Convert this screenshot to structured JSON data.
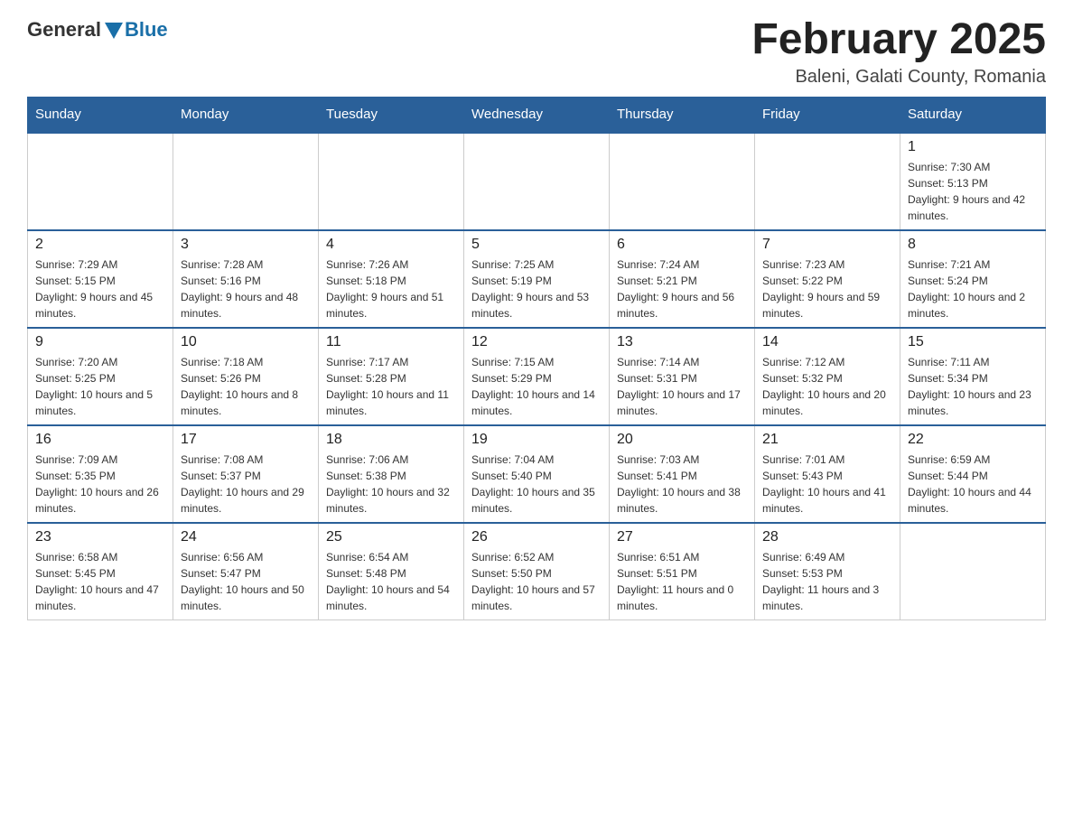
{
  "header": {
    "logo_general": "General",
    "logo_blue": "Blue",
    "month_year": "February 2025",
    "location": "Baleni, Galati County, Romania"
  },
  "weekdays": [
    "Sunday",
    "Monday",
    "Tuesday",
    "Wednesday",
    "Thursday",
    "Friday",
    "Saturday"
  ],
  "weeks": [
    {
      "days": [
        {
          "number": "",
          "info": ""
        },
        {
          "number": "",
          "info": ""
        },
        {
          "number": "",
          "info": ""
        },
        {
          "number": "",
          "info": ""
        },
        {
          "number": "",
          "info": ""
        },
        {
          "number": "",
          "info": ""
        },
        {
          "number": "1",
          "info": "Sunrise: 7:30 AM\nSunset: 5:13 PM\nDaylight: 9 hours and 42 minutes."
        }
      ]
    },
    {
      "days": [
        {
          "number": "2",
          "info": "Sunrise: 7:29 AM\nSunset: 5:15 PM\nDaylight: 9 hours and 45 minutes."
        },
        {
          "number": "3",
          "info": "Sunrise: 7:28 AM\nSunset: 5:16 PM\nDaylight: 9 hours and 48 minutes."
        },
        {
          "number": "4",
          "info": "Sunrise: 7:26 AM\nSunset: 5:18 PM\nDaylight: 9 hours and 51 minutes."
        },
        {
          "number": "5",
          "info": "Sunrise: 7:25 AM\nSunset: 5:19 PM\nDaylight: 9 hours and 53 minutes."
        },
        {
          "number": "6",
          "info": "Sunrise: 7:24 AM\nSunset: 5:21 PM\nDaylight: 9 hours and 56 minutes."
        },
        {
          "number": "7",
          "info": "Sunrise: 7:23 AM\nSunset: 5:22 PM\nDaylight: 9 hours and 59 minutes."
        },
        {
          "number": "8",
          "info": "Sunrise: 7:21 AM\nSunset: 5:24 PM\nDaylight: 10 hours and 2 minutes."
        }
      ]
    },
    {
      "days": [
        {
          "number": "9",
          "info": "Sunrise: 7:20 AM\nSunset: 5:25 PM\nDaylight: 10 hours and 5 minutes."
        },
        {
          "number": "10",
          "info": "Sunrise: 7:18 AM\nSunset: 5:26 PM\nDaylight: 10 hours and 8 minutes."
        },
        {
          "number": "11",
          "info": "Sunrise: 7:17 AM\nSunset: 5:28 PM\nDaylight: 10 hours and 11 minutes."
        },
        {
          "number": "12",
          "info": "Sunrise: 7:15 AM\nSunset: 5:29 PM\nDaylight: 10 hours and 14 minutes."
        },
        {
          "number": "13",
          "info": "Sunrise: 7:14 AM\nSunset: 5:31 PM\nDaylight: 10 hours and 17 minutes."
        },
        {
          "number": "14",
          "info": "Sunrise: 7:12 AM\nSunset: 5:32 PM\nDaylight: 10 hours and 20 minutes."
        },
        {
          "number": "15",
          "info": "Sunrise: 7:11 AM\nSunset: 5:34 PM\nDaylight: 10 hours and 23 minutes."
        }
      ]
    },
    {
      "days": [
        {
          "number": "16",
          "info": "Sunrise: 7:09 AM\nSunset: 5:35 PM\nDaylight: 10 hours and 26 minutes."
        },
        {
          "number": "17",
          "info": "Sunrise: 7:08 AM\nSunset: 5:37 PM\nDaylight: 10 hours and 29 minutes."
        },
        {
          "number": "18",
          "info": "Sunrise: 7:06 AM\nSunset: 5:38 PM\nDaylight: 10 hours and 32 minutes."
        },
        {
          "number": "19",
          "info": "Sunrise: 7:04 AM\nSunset: 5:40 PM\nDaylight: 10 hours and 35 minutes."
        },
        {
          "number": "20",
          "info": "Sunrise: 7:03 AM\nSunset: 5:41 PM\nDaylight: 10 hours and 38 minutes."
        },
        {
          "number": "21",
          "info": "Sunrise: 7:01 AM\nSunset: 5:43 PM\nDaylight: 10 hours and 41 minutes."
        },
        {
          "number": "22",
          "info": "Sunrise: 6:59 AM\nSunset: 5:44 PM\nDaylight: 10 hours and 44 minutes."
        }
      ]
    },
    {
      "days": [
        {
          "number": "23",
          "info": "Sunrise: 6:58 AM\nSunset: 5:45 PM\nDaylight: 10 hours and 47 minutes."
        },
        {
          "number": "24",
          "info": "Sunrise: 6:56 AM\nSunset: 5:47 PM\nDaylight: 10 hours and 50 minutes."
        },
        {
          "number": "25",
          "info": "Sunrise: 6:54 AM\nSunset: 5:48 PM\nDaylight: 10 hours and 54 minutes."
        },
        {
          "number": "26",
          "info": "Sunrise: 6:52 AM\nSunset: 5:50 PM\nDaylight: 10 hours and 57 minutes."
        },
        {
          "number": "27",
          "info": "Sunrise: 6:51 AM\nSunset: 5:51 PM\nDaylight: 11 hours and 0 minutes."
        },
        {
          "number": "28",
          "info": "Sunrise: 6:49 AM\nSunset: 5:53 PM\nDaylight: 11 hours and 3 minutes."
        },
        {
          "number": "",
          "info": ""
        }
      ]
    }
  ]
}
